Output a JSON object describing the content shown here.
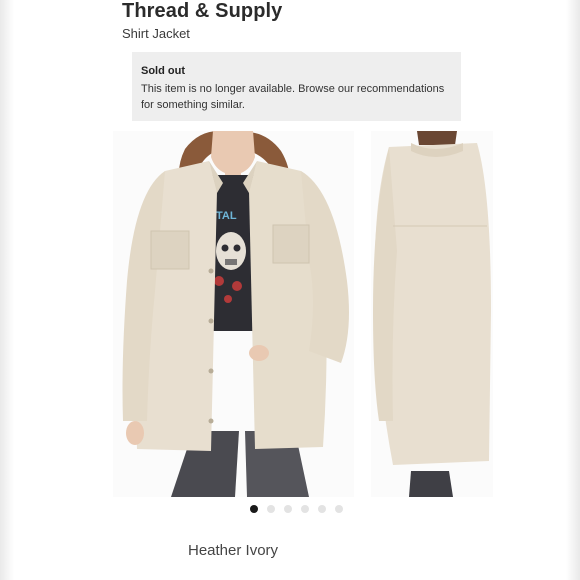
{
  "product": {
    "brand": "Thread & Supply",
    "name": "Shirt Jacket"
  },
  "notice": {
    "title": "Sold out",
    "text": "This item is no longer available. Browse our recommendations for something similar."
  },
  "gallery": {
    "total_images": 6,
    "active_index": 0
  },
  "selected_color": "Heather Ivory",
  "colors": {
    "jacket": "#e8dfd0",
    "notice_bg": "#eeeeee",
    "active_dot": "#1a1a1a",
    "inactive_dot": "#e3e3e3"
  }
}
